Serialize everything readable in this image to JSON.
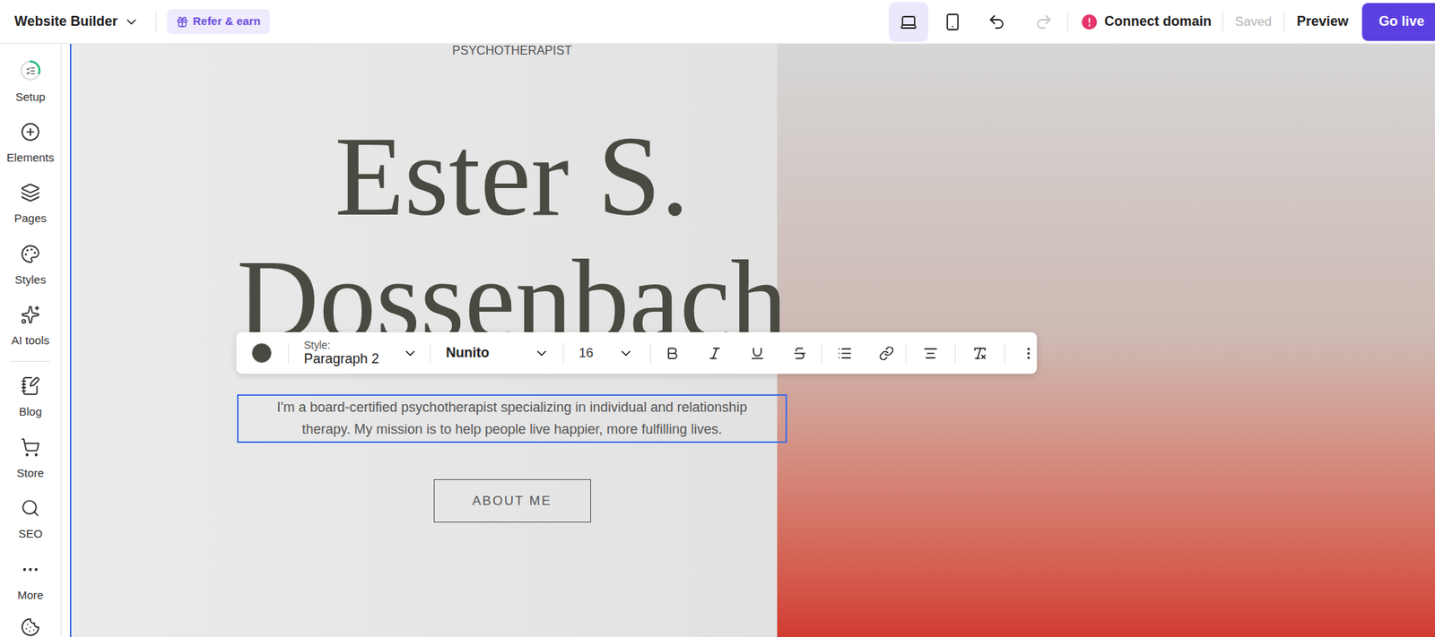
{
  "topbar": {
    "app_title": "Website Builder",
    "refer": "Refer & earn",
    "devices": [
      {
        "name": "desktop",
        "selected": true
      },
      {
        "name": "mobile",
        "selected": false
      }
    ],
    "undo_disabled": false,
    "redo_disabled": true,
    "alert": true,
    "connect_domain": "Connect domain",
    "save_status": "Saved",
    "preview": "Preview",
    "go_live": "Go live"
  },
  "sidebar": {
    "primary": [
      {
        "label": "Setup",
        "level": 0.3
      },
      {
        "label": "Elements"
      },
      {
        "label": "Pages"
      },
      {
        "label": "Styles"
      },
      {
        "label": "AI tools"
      }
    ],
    "secondary": [
      {
        "label": "Blog"
      },
      {
        "label": "Store"
      },
      {
        "label": "SEO"
      },
      {
        "label": "More"
      }
    ]
  },
  "toolbar": {
    "text_color": "#4a4a42",
    "style_label": "Style:",
    "style_value": "Paragraph 2",
    "font": "Nunito",
    "size": "16",
    "bold": false,
    "italic": false,
    "underline": false,
    "strikethrough": false
  },
  "hero": {
    "eyebrow": "PSYCHOTHERAPIST",
    "title_lines": [
      "Ester S.",
      "Dossenbach"
    ],
    "body_lines": [
      "I'm a board-certified psychotherapist specializing in individual and relationship",
      "therapy. My mission is to help people live happier, more fulfilling lives."
    ],
    "body_selected": true,
    "button": "ABOUT ME"
  }
}
